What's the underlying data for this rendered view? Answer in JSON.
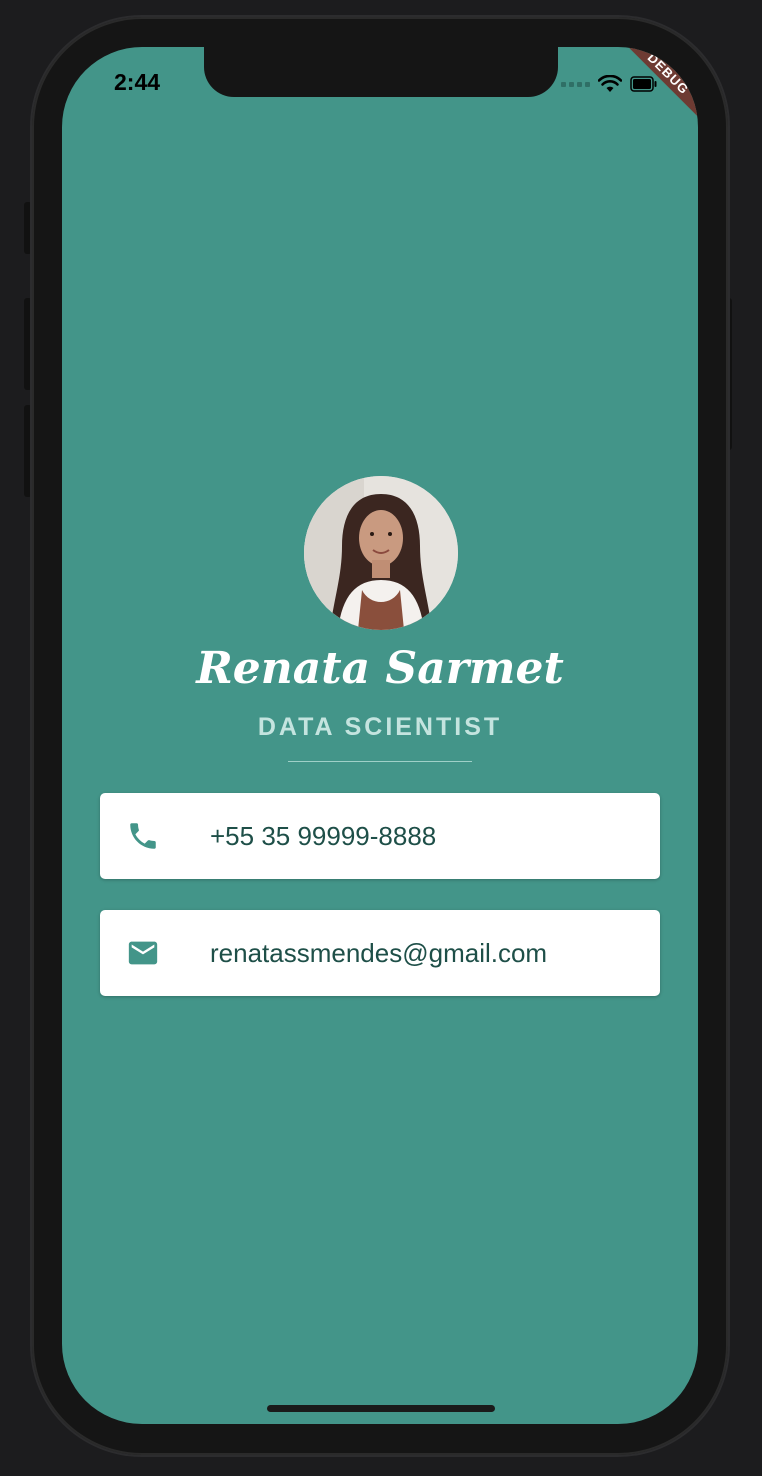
{
  "status_bar": {
    "time": "2:44",
    "debug_label": "DEBUG"
  },
  "profile": {
    "name": "Renata Sarmet",
    "title": "DATA SCIENTIST",
    "avatar_icon": "profile-photo"
  },
  "contacts": {
    "phone": {
      "icon": "phone-icon",
      "value": "+55 35 99999-8888"
    },
    "email": {
      "icon": "mail-icon",
      "value": "renatassmendes@gmail.com"
    }
  },
  "colors": {
    "background": "#439589",
    "card": "#ffffff",
    "icon": "#439589",
    "text": "#1e4f48",
    "subtitle": "#c4e4df",
    "debug_banner": "#6e3b33"
  }
}
